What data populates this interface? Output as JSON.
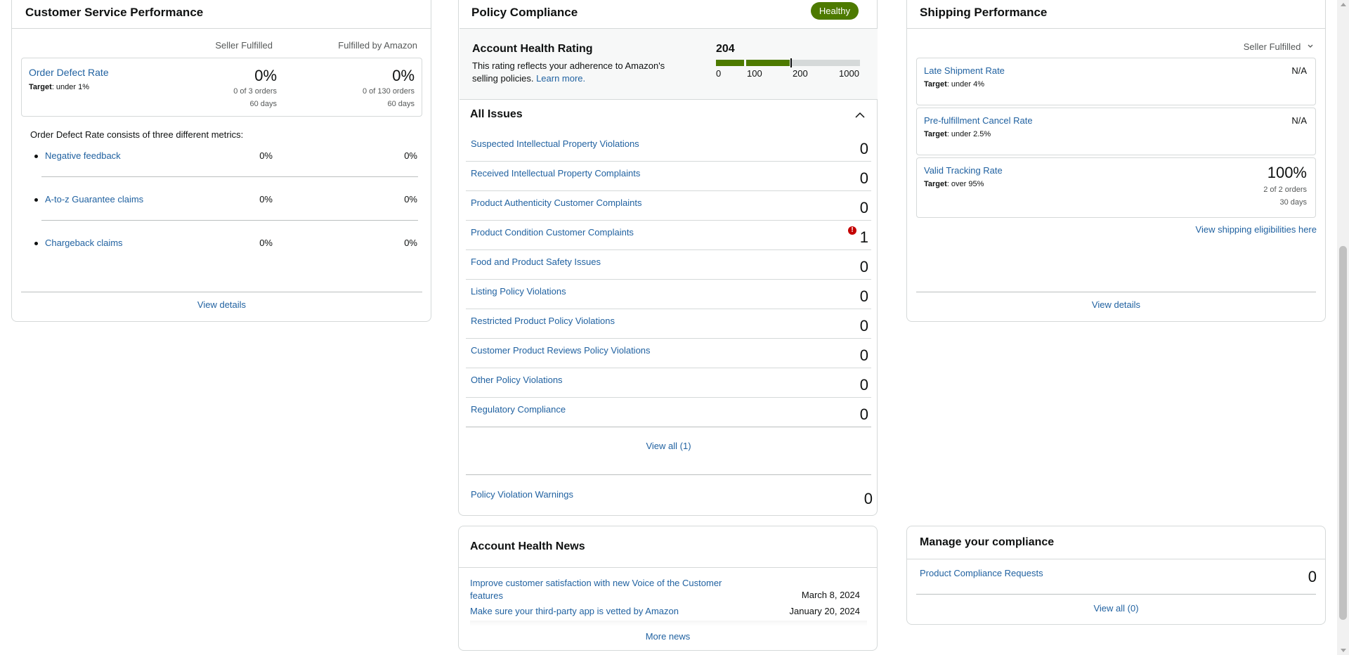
{
  "customer_service": {
    "title": "Customer Service Performance",
    "col_seller": "Seller Fulfilled",
    "col_amazon": "Fulfilled by Amazon",
    "odr": {
      "label": "Order Defect Rate",
      "target_prefix": "Target",
      "target_value": ": under 1%",
      "seller_pct": "0%",
      "seller_orders": "0 of 3 orders",
      "seller_days": "60 days",
      "amazon_pct": "0%",
      "amazon_orders": "0 of 130 orders",
      "amazon_days": "60 days"
    },
    "consists_text": "Order Defect Rate consists of three different metrics:",
    "metrics": [
      {
        "label": "Negative feedback",
        "seller": "0%",
        "amazon": "0%"
      },
      {
        "label": "A-to-z Guarantee claims",
        "seller": "0%",
        "amazon": "0%"
      },
      {
        "label": "Chargeback claims",
        "seller": "0%",
        "amazon": "0%"
      }
    ],
    "view_details": "View details"
  },
  "policy": {
    "title": "Policy Compliance",
    "status_badge": "Healthy",
    "status_color": "#4d7a00",
    "ahr_title": "Account Health Rating",
    "ahr_desc": "This rating reflects your adherence to Amazon's selling policies.",
    "ahr_learn_more": "Learn more.",
    "ahr_score": "204",
    "ahr_score_value": 204,
    "scale_labels": [
      "0",
      "100",
      "200",
      "1000"
    ],
    "issues_title": "All Issues",
    "issues": [
      {
        "label": "Suspected Intellectual Property Violations",
        "count": "0",
        "alert": false
      },
      {
        "label": "Received Intellectual Property Complaints",
        "count": "0",
        "alert": false
      },
      {
        "label": "Product Authenticity Customer Complaints",
        "count": "0",
        "alert": false
      },
      {
        "label": "Product Condition Customer Complaints",
        "count": "1",
        "alert": true
      },
      {
        "label": "Food and Product Safety Issues",
        "count": "0",
        "alert": false
      },
      {
        "label": "Listing Policy Violations",
        "count": "0",
        "alert": false
      },
      {
        "label": "Restricted Product Policy Violations",
        "count": "0",
        "alert": false
      },
      {
        "label": "Customer Product Reviews Policy Violations",
        "count": "0",
        "alert": false
      },
      {
        "label": "Other Policy Violations",
        "count": "0",
        "alert": false
      },
      {
        "label": "Regulatory Compliance",
        "count": "0",
        "alert": false
      }
    ],
    "view_all": "View all (1)",
    "warnings_label": "Policy Violation Warnings",
    "warnings_count": "0"
  },
  "shipping": {
    "title": "Shipping Performance",
    "filter": "Seller Fulfilled",
    "metrics": [
      {
        "label": "Late Shipment Rate",
        "target_prefix": "Target",
        "target_value": ": under 4%",
        "value": "N/A"
      },
      {
        "label": "Pre-fulfillment Cancel Rate",
        "target_prefix": "Target",
        "target_value": ": under 2.5%",
        "value": "N/A"
      },
      {
        "label": "Valid Tracking Rate",
        "target_prefix": "Target",
        "target_value": ": over 95%",
        "value": "100%",
        "orders": "2 of 2 orders",
        "days": "30 days"
      }
    ],
    "eligibilities_link": "View shipping eligibilities here",
    "view_details": "View details"
  },
  "news": {
    "title": "Account Health News",
    "items": [
      {
        "title": "Improve customer satisfaction with new Voice of the Customer features",
        "date": "March 8, 2024"
      },
      {
        "title": "Make sure your third-party app is vetted by Amazon",
        "date": "January 20, 2024"
      }
    ],
    "more": "More news"
  },
  "compliance": {
    "title": "Manage your compliance",
    "requests_label": "Product Compliance Requests",
    "requests_count": "0",
    "view_all": "View all (0)"
  },
  "icons": {
    "collapse": "chevron-up-icon",
    "dropdown": "chevron-down-icon",
    "alert": "alert-icon"
  }
}
